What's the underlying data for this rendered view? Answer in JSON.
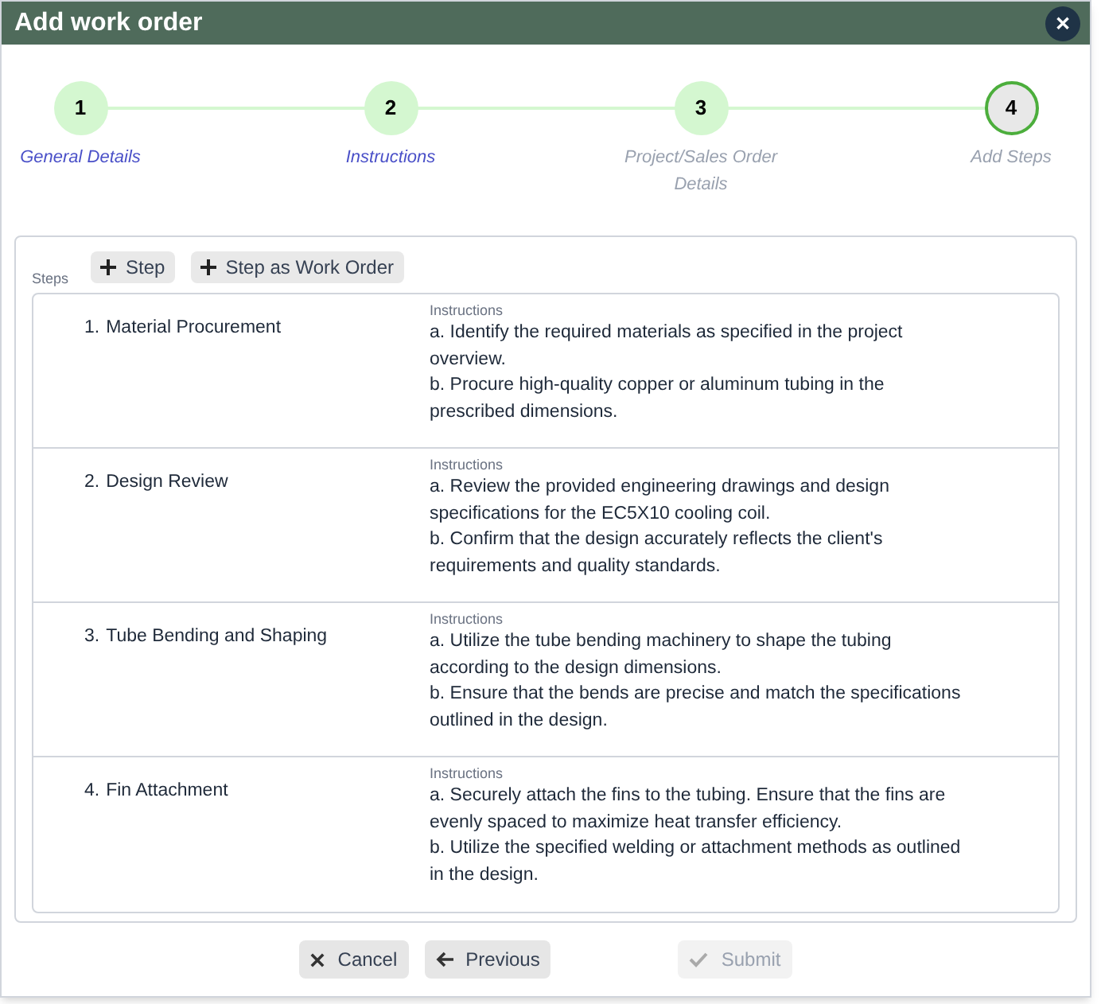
{
  "window": {
    "title": "Add work order",
    "close": "✕"
  },
  "stepper": [
    {
      "number": "1",
      "label": "General Details",
      "kind": "complete"
    },
    {
      "number": "2",
      "label": "Instructions",
      "kind": "complete"
    },
    {
      "number": "3",
      "label": "Project/Sales Order Details",
      "kind": "pending"
    },
    {
      "number": "4",
      "label": "Add Steps",
      "kind": "current"
    }
  ],
  "steps_panel": {
    "label": "Steps",
    "actions": [
      "Step",
      "Step as Work Order"
    ],
    "steps": [
      {
        "number": "1.",
        "title": "Material Procurement",
        "instructions_label": "Instructions",
        "instructions": [
          "a. Identify the required materials as specified in the project overview.",
          "b. Procure high-quality copper or aluminum tubing in the prescribed dimensions."
        ]
      },
      {
        "number": "2.",
        "title": "Design Review",
        "instructions_label": "Instructions",
        "instructions": [
          "a. Review the provided engineering drawings and design specifications for the EC5X10 cooling coil.",
          "b. Confirm that the design accurately reflects the client's requirements and quality standards."
        ]
      },
      {
        "number": "3.",
        "title": "Tube Bending and Shaping",
        "instructions_label": "Instructions",
        "instructions": [
          "a. Utilize the tube bending machinery to shape the tubing according to the design dimensions.",
          "b. Ensure that the bends are precise and match the specifications outlined in the design."
        ]
      },
      {
        "number": "4.",
        "title": "Fin Attachment",
        "instructions_label": "Instructions",
        "instructions": [
          "a. Securely attach the fins to the tubing. Ensure that the fins are evenly spaced to maximize heat transfer efficiency.",
          "b. Utilize the specified welding or attachment methods as outlined in the design."
        ]
      }
    ]
  },
  "footer": [
    {
      "kind": "cancel",
      "label": "Cancel",
      "disabled": false
    },
    {
      "kind": "previous",
      "label": "Previous",
      "disabled": false
    },
    {
      "kind": "submit",
      "label": "Submit",
      "disabled": true
    }
  ]
}
